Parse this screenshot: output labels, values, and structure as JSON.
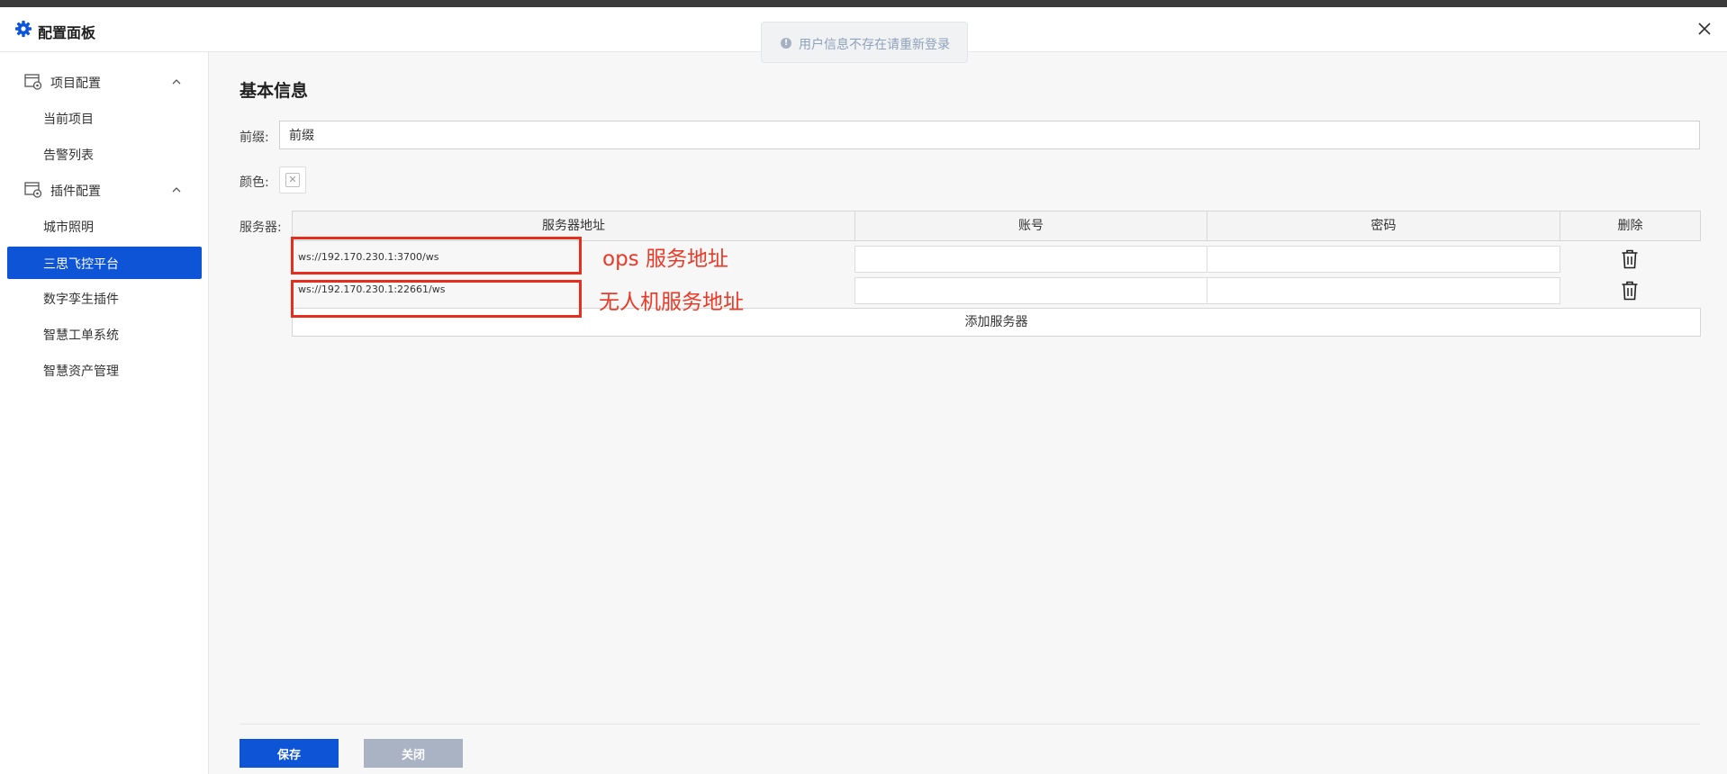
{
  "header": {
    "title": "配置面板"
  },
  "toast": {
    "message": "用户信息不存在请重新登录"
  },
  "sidebar": {
    "groups": [
      {
        "label": "项目配置",
        "items": [
          "当前项目",
          "告警列表"
        ]
      },
      {
        "label": "插件配置",
        "items": [
          "城市照明",
          "三思飞控平台",
          "数字孪生插件",
          "智慧工单系统",
          "智慧资产管理"
        ]
      }
    ],
    "active_item": "三思飞控平台"
  },
  "main": {
    "section_title": "基本信息",
    "prefix": {
      "label": "前缀:",
      "value": "前缀"
    },
    "color": {
      "label": "颜色:"
    },
    "servers": {
      "label": "服务器:",
      "columns": [
        "服务器地址",
        "账号",
        "密码",
        "删除"
      ],
      "rows": [
        {
          "address": "ws://192.170.230.1:3700/ws",
          "account": "",
          "password": ""
        },
        {
          "address": "ws://192.170.230.1:22661/ws",
          "account": "",
          "password": ""
        }
      ],
      "add_label": "添加服务器"
    },
    "annotations": [
      "ops 服务地址",
      "无人机服务地址"
    ]
  },
  "footer": {
    "save_label": "保存",
    "close_label": "关闭"
  },
  "colors": {
    "accent": "#0d54d6",
    "annotation": "#e52e1e",
    "disabled_button": "#a9b3c4"
  }
}
